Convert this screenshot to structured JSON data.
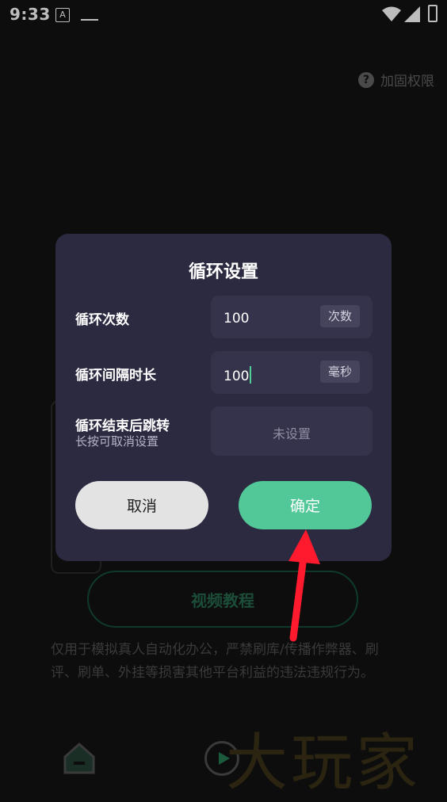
{
  "status_bar": {
    "time": "9:33",
    "a_icon_text": "A"
  },
  "background": {
    "permission_link": "加固权限",
    "video_button": "视频教程",
    "disclaimer": "仅用于模拟真人自动化办公，严禁刷库/传播作弊器、刷评、刷单、外挂等损害其他平台利益的违法违规行为。",
    "watermark": "大玩家"
  },
  "dialog": {
    "title": "循环设置",
    "loop_count": {
      "label": "循环次数",
      "value": "100",
      "unit": "次数"
    },
    "loop_interval": {
      "label": "循环间隔时长",
      "value": "100",
      "unit": "毫秒"
    },
    "jump_after": {
      "label": "循环结束后跳转",
      "hint": "长按可取消设置",
      "placeholder": "未设置"
    },
    "cancel_label": "取消",
    "confirm_label": "确定"
  },
  "colors": {
    "dialog_bg": "#2b2a40",
    "field_bg": "#34334b",
    "accent": "#52c797",
    "annotation_arrow": "#ff1a2e"
  }
}
